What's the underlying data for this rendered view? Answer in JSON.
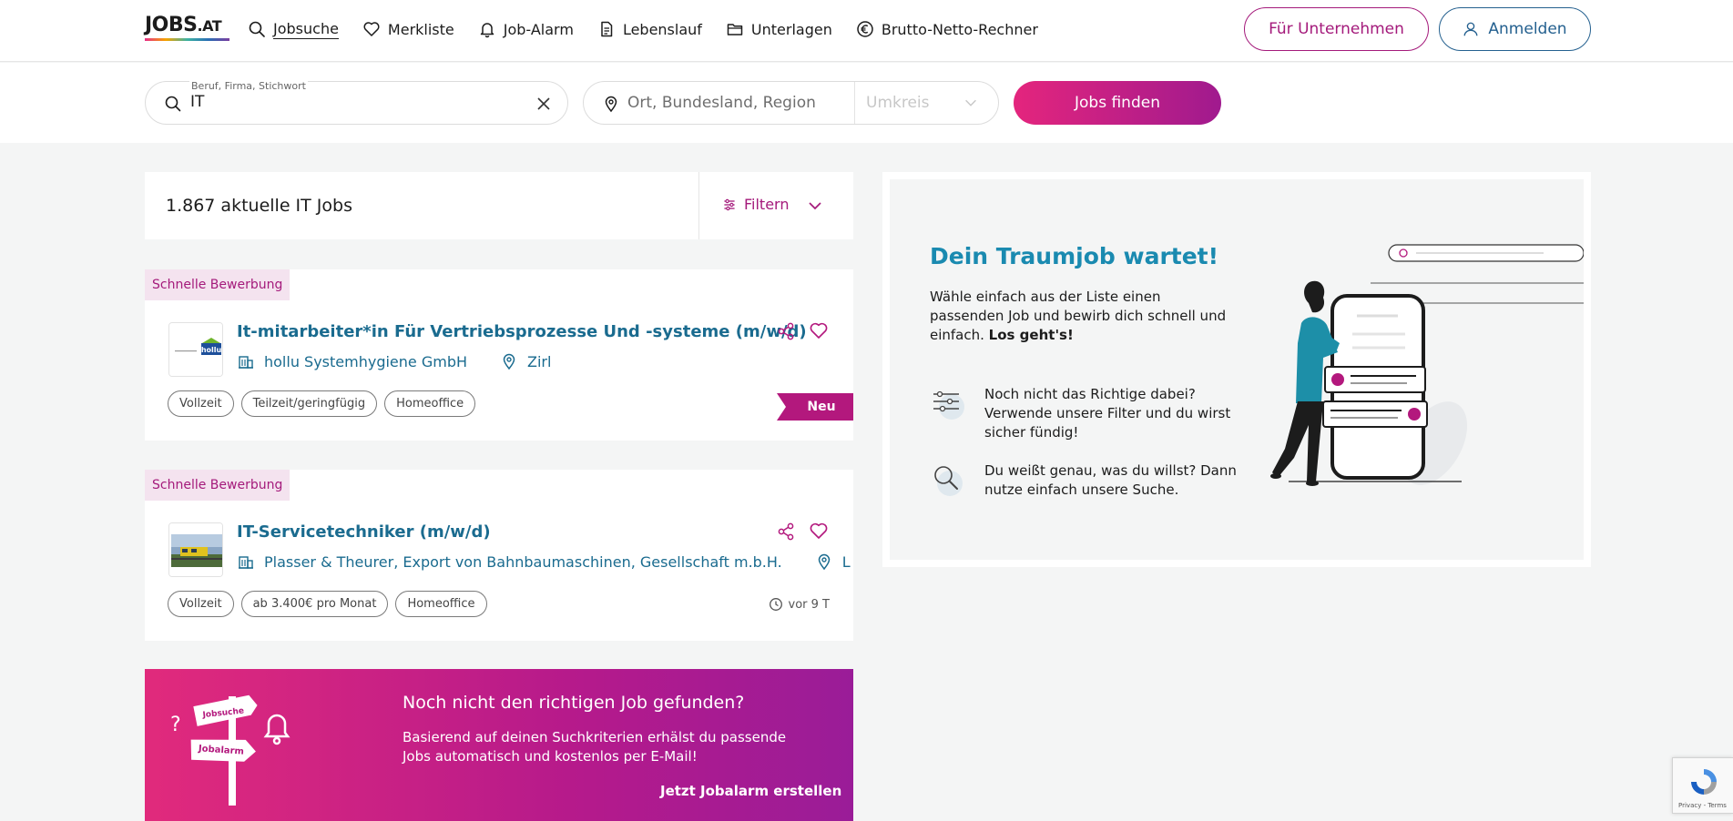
{
  "header": {
    "logo_main": "JOBS",
    "logo_suffix": ".AT",
    "nav": [
      {
        "label": "Jobsuche",
        "icon": "search-icon"
      },
      {
        "label": "Merkliste",
        "icon": "heart-icon"
      },
      {
        "label": "Job-Alarm",
        "icon": "bell-icon"
      },
      {
        "label": "Lebenslauf",
        "icon": "document-icon"
      },
      {
        "label": "Unterlagen",
        "icon": "folder-icon"
      },
      {
        "label": "Brutto-Netto-Rechner",
        "icon": "euro-icon"
      }
    ],
    "for_companies": "Für Unternehmen",
    "login": "Anmelden"
  },
  "search": {
    "query_label": "Beruf, Firma, Stichwort",
    "query_value": "IT",
    "location_placeholder": "Ort, Bundesland, Region",
    "radius_placeholder": "Umkreis",
    "submit": "Jobs finden"
  },
  "results": {
    "count_text": "1.867 aktuelle IT Jobs",
    "filter_label": "Filtern"
  },
  "jobs": [
    {
      "badge": "Schnelle Bewerbung",
      "title": "It-mitarbeiter*in Für Vertriebsprozesse Und -systeme (m/w/d)",
      "company": "hollu Systemhygiene GmbH",
      "location": "Zirl",
      "logo_text": "hollu",
      "tags": [
        "Vollzeit",
        "Teilzeit/geringfügig",
        "Homeoffice"
      ],
      "new_label": "Neu"
    },
    {
      "badge": "Schnelle Bewerbung",
      "title": "IT-Servicetechniker (m/w/d)",
      "company": "Plasser & Theurer, Export von Bahnbaumaschinen, Gesellschaft m.b.H.",
      "location": "L",
      "tags": [
        "Vollzeit",
        "ab 3.400€ pro Monat",
        "Homeoffice"
      ],
      "posted": "vor 9 T"
    }
  ],
  "jobalarm": {
    "sign_top": "Jobsuche",
    "sign_bottom": "Jobalarm",
    "title": "Noch nicht den richtigen Job gefunden?",
    "text": "Basierend auf deinen Suchkriterien erhälst du passende Jobs automatisch und kostenlos per E-Mail!",
    "cta": "Jetzt Jobalarm erstellen"
  },
  "promo": {
    "title": "Dein Traumjob wartet!",
    "text_main": "Wähle einfach aus der Liste einen passenden Job und bewirb dich schnell und einfach. ",
    "text_bold": "Los geht's!",
    "tips": [
      {
        "icon": "filter-sliders-icon",
        "text": "Noch nicht das Richtige dabei? Verwende unsere Filter und du wirst sicher fündig!"
      },
      {
        "icon": "magnifier-icon",
        "text": "Du weißt genau, was du willst? Dann nutze einfach unsere Suche."
      }
    ]
  },
  "recaptcha": {
    "terms": "Privacy - Terms"
  },
  "colors": {
    "brand_magenta": "#a41a7b",
    "brand_blue": "#1a6b8f",
    "promo_title": "#1a8ab0"
  }
}
